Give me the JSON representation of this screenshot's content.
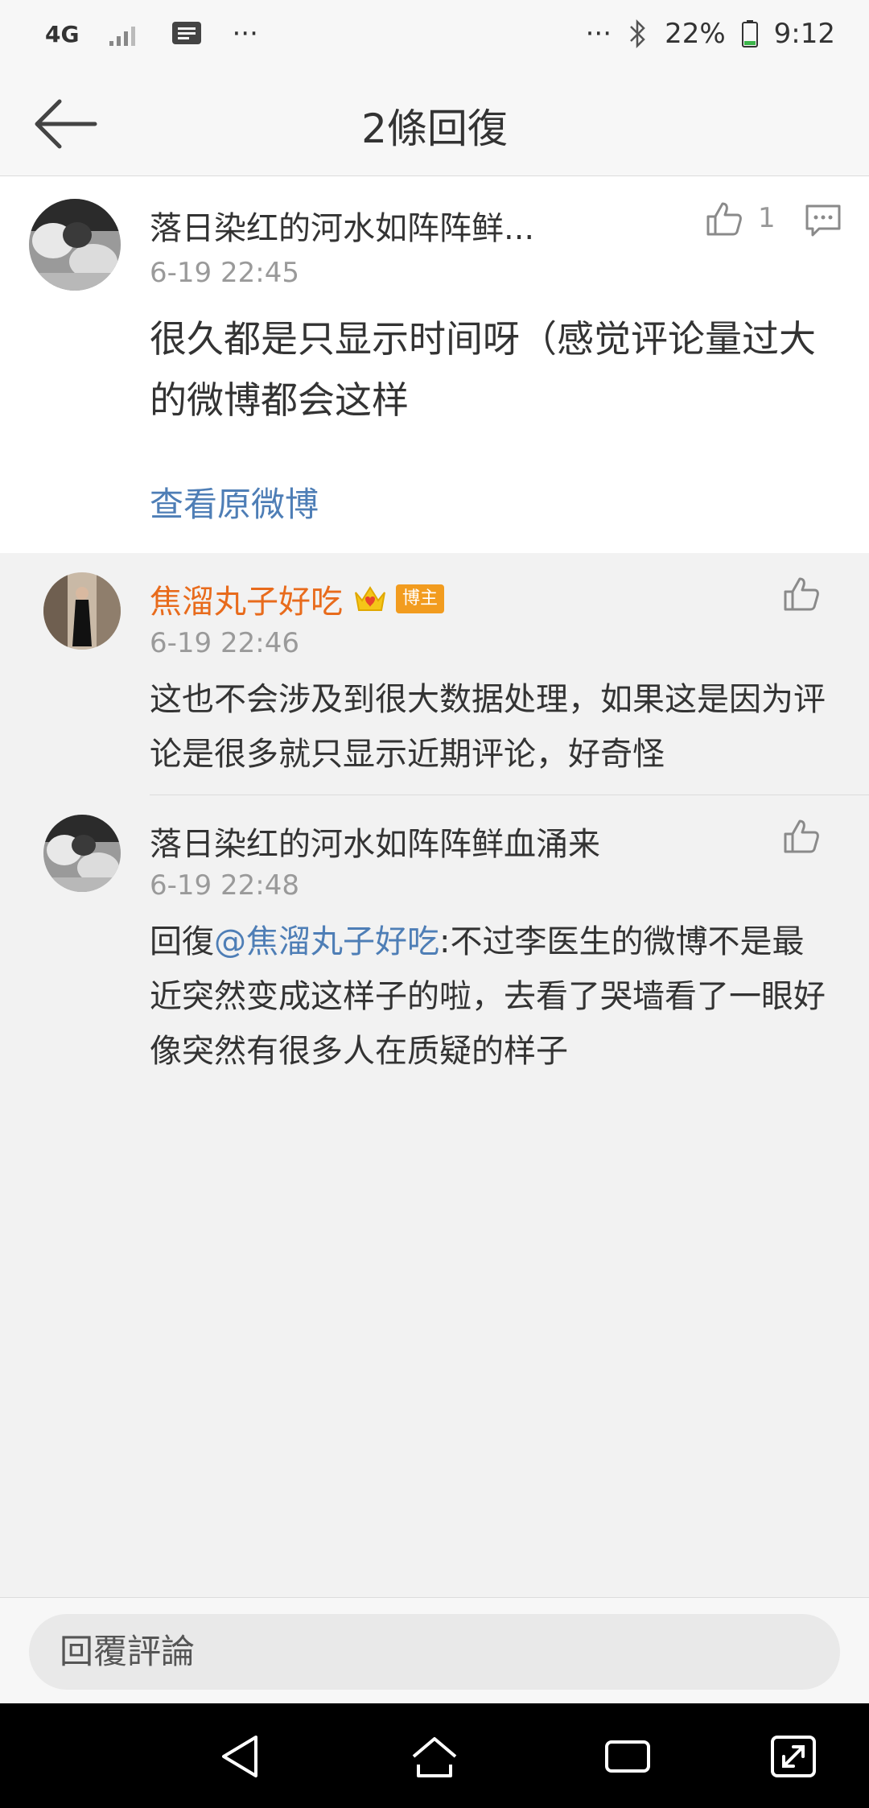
{
  "status_bar": {
    "network": "4G",
    "more_left": "···",
    "more_right": "···",
    "battery": "22%",
    "time": "9:12"
  },
  "header": {
    "title": "2條回復"
  },
  "main_comment": {
    "username": "落日染红的河水如阵阵鲜...",
    "time": "6-19 22:45",
    "text": "很久都是只显示时间呀（感觉评论量过大的微博都会这样",
    "like_count": "1",
    "view_original": "查看原微博"
  },
  "replies": [
    {
      "username": "焦溜丸子好吃",
      "badge": "博主",
      "time": "6-19 22:46",
      "text": "这也不会涉及到很大数据处理，如果这是因为评论是很多就只显示近期评论，好奇怪"
    },
    {
      "username": "落日染红的河水如阵阵鲜血涌来",
      "time": "6-19 22:48",
      "reply_prefix": "回復",
      "mention": "@焦溜丸子好吃",
      "text": ":不过李医生的微博不是最近突然变成这样子的啦，去看了哭墙看了一眼好像突然有很多人在质疑的样子"
    }
  ],
  "reply_bar": {
    "placeholder": "回覆評論"
  },
  "colors": {
    "link": "#4e7eb6",
    "username_highlight": "#e86b1c",
    "badge": "#f29c1f",
    "background": "#f2f2f2"
  },
  "icons": [
    "back-arrow-icon",
    "like-icon",
    "comment-icon",
    "crown-icon",
    "bluetooth-icon",
    "battery-icon",
    "signal-icon",
    "message-icon",
    "nav-back-icon",
    "nav-home-icon",
    "nav-recents-icon",
    "nav-expand-icon"
  ]
}
